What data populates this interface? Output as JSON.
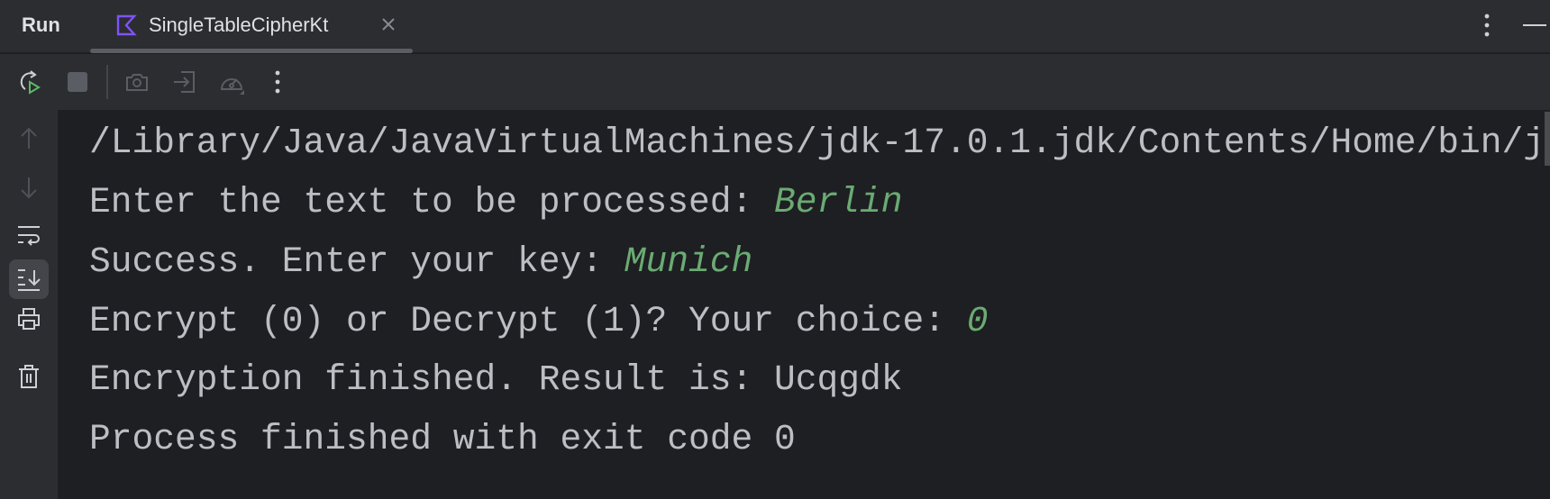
{
  "header": {
    "panel_title": "Run",
    "tab": {
      "title": "SingleTableCipherKt",
      "icon": "kotlin-icon"
    },
    "actions": [
      "more-icon",
      "minimize-icon"
    ]
  },
  "toolbar": {
    "buttons": [
      "rerun-icon",
      "stop-icon",
      "camera-icon",
      "exit-icon",
      "gauge-icon",
      "more-icon"
    ]
  },
  "gutter": {
    "buttons": [
      "arrow-up-icon",
      "arrow-down-icon",
      "soft-wrap-icon",
      "scroll-to-end-icon",
      "print-icon",
      "trash-icon"
    ]
  },
  "console": {
    "lines": [
      {
        "text": "/Library/Java/JavaVirtualMachines/jdk-17.0.1.jdk/Contents/Home/bin/j",
        "input": ""
      },
      {
        "text": "Enter the text to be processed: ",
        "input": "Berlin"
      },
      {
        "text": "Success. Enter your key: ",
        "input": "Munich"
      },
      {
        "text": "Encrypt (0) or Decrypt (1)? Your choice: ",
        "input": "0"
      },
      {
        "text": "Encryption finished. Result is: Ucqgdk",
        "input": ""
      },
      {
        "text": "Process finished with exit code 0",
        "input": ""
      }
    ]
  },
  "colors": {
    "background": "#1e1f22",
    "panel": "#2b2d30",
    "text": "#bcbec4",
    "user_input": "#6aab73"
  }
}
